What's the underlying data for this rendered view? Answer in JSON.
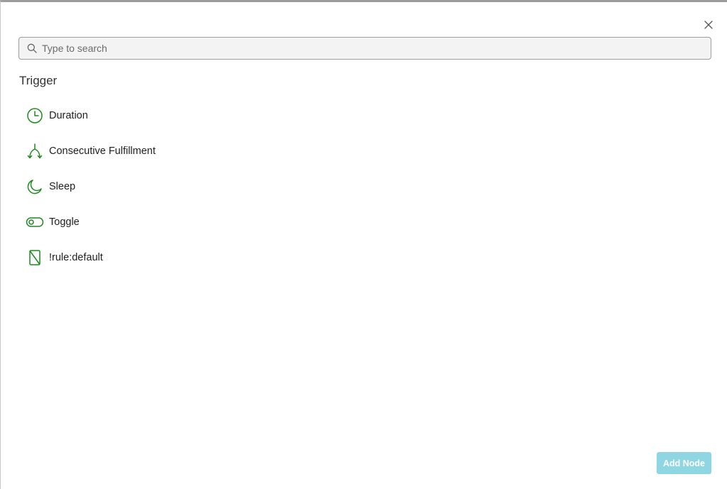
{
  "search": {
    "placeholder": "Type to search",
    "value": ""
  },
  "section": {
    "title": "Trigger"
  },
  "items": [
    {
      "label": "Duration",
      "icon": "clock-icon"
    },
    {
      "label": "Consecutive Fulfillment",
      "icon": "merge-arrows-icon"
    },
    {
      "label": "Sleep",
      "icon": "moon-icon"
    },
    {
      "label": "Toggle",
      "icon": "toggle-icon"
    },
    {
      "label": "!rule:default",
      "icon": "no-rule-icon"
    }
  ],
  "footer": {
    "add_label": "Add Node"
  },
  "colors": {
    "icon_green": "#1d8a1d",
    "button_disabled": "#8dd6e2",
    "search_bg": "#f3f3f3"
  }
}
